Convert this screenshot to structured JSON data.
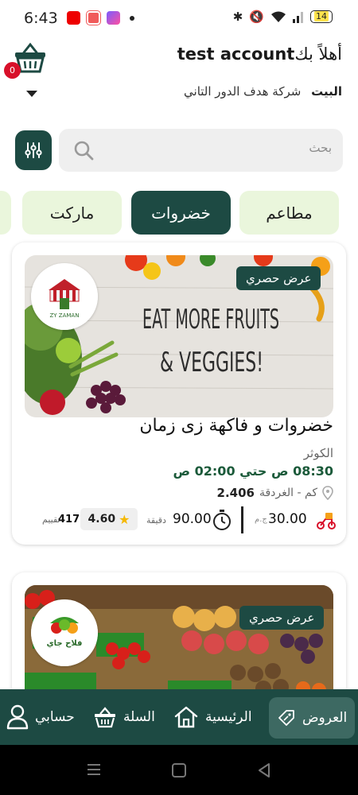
{
  "status_bar": {
    "time": "6:43",
    "battery": "14",
    "apps": [
      "youtube-icon",
      "screen-recorder-icon",
      "messenger-icon"
    ]
  },
  "header": {
    "greeting": "أهلاً بك",
    "account_name": "test account",
    "cart_count": "0",
    "address_label": "البيت",
    "address_value": "شركة هدف الدور التاني"
  },
  "search": {
    "placeholder": "بحث"
  },
  "categories": [
    {
      "label": "مطاعم",
      "active": false
    },
    {
      "label": "خضروات",
      "active": true
    },
    {
      "label": "ماركت",
      "active": false
    }
  ],
  "stores": [
    {
      "name": "خضروات و فاكهة زى زمان",
      "badge": "عرض حصري",
      "logo_text": "ZY ZAMAN",
      "banner_line1": "EAT MORE FRUITS",
      "banner_line2": "& VEGGIES!",
      "area": "الكوثر",
      "hours": "08:30 ص  حتي 02:00 ص",
      "distance": "2.406",
      "distance_unit": "كم - الغردقة",
      "delivery_fee": "30.00",
      "currency": "ج.م",
      "delivery_time": "90.00",
      "time_unit": "دقيقة",
      "rating": "4.60",
      "reviews": "417",
      "reviews_label": "تقييم"
    },
    {
      "badge": "عرض حصري",
      "logo_text": "فلاح جاي"
    }
  ],
  "bottom_nav": [
    {
      "label": "العروض",
      "icon": "offers-tag-icon",
      "active": true
    },
    {
      "label": "الرئيسية",
      "icon": "home-icon",
      "active": false
    },
    {
      "label": "السلة",
      "icon": "basket-icon",
      "active": false
    },
    {
      "label": "حسابي",
      "icon": "user-icon",
      "active": false
    }
  ],
  "colors": {
    "primary": "#1d4a43",
    "category_bg": "#eaf6dc",
    "badge_red": "#d8102a",
    "hours_green": "#1b5a3a"
  }
}
